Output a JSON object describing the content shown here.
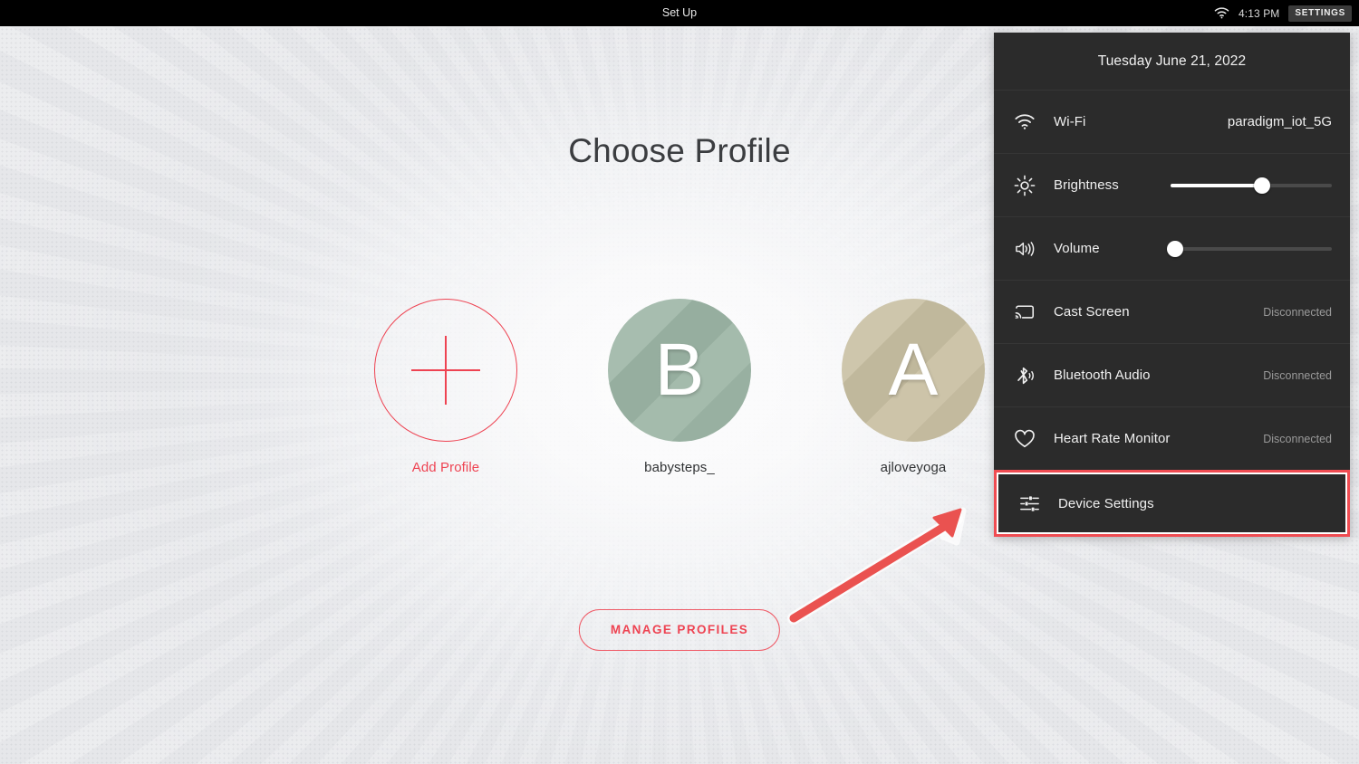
{
  "topbar": {
    "title": "Set Up",
    "wifi_icon": "wifi-icon",
    "clock": "4:13 PM",
    "settings_button": "SETTINGS"
  },
  "main": {
    "page_title": "Choose Profile",
    "manage_profiles_button": "MANAGE PROFILES",
    "profiles": [
      {
        "type": "add",
        "label": "Add Profile",
        "icon": "plus-icon",
        "color": "#ee4352"
      },
      {
        "type": "user",
        "label": "babysteps_",
        "initial": "B",
        "color": "#9db6a6"
      },
      {
        "type": "user",
        "label": "ajloveyoga",
        "initial": "A",
        "color": "#c9c0a3"
      }
    ]
  },
  "settings_panel": {
    "date": "Tuesday June 21, 2022",
    "rows": [
      {
        "icon": "wifi-icon",
        "label": "Wi-Fi",
        "value": "paradigm_iot_5G",
        "value_muted": false
      },
      {
        "icon": "brightness-icon",
        "label": "Brightness",
        "slider": 57
      },
      {
        "icon": "volume-icon",
        "label": "Volume",
        "slider": 3
      },
      {
        "icon": "cast-screen-icon",
        "label": "Cast Screen",
        "value": "Disconnected",
        "value_muted": true
      },
      {
        "icon": "bluetooth-audio-icon",
        "label": "Bluetooth Audio",
        "value": "Disconnected",
        "value_muted": true
      },
      {
        "icon": "heart-icon",
        "label": "Heart Rate Monitor",
        "value": "Disconnected",
        "value_muted": true
      }
    ],
    "device_settings": {
      "icon": "sliders-icon",
      "label": "Device Settings",
      "highlight_color": "#f04c52"
    }
  },
  "annotation": {
    "arrow_color": "#ea5250",
    "arrow_target": "Device Settings"
  }
}
